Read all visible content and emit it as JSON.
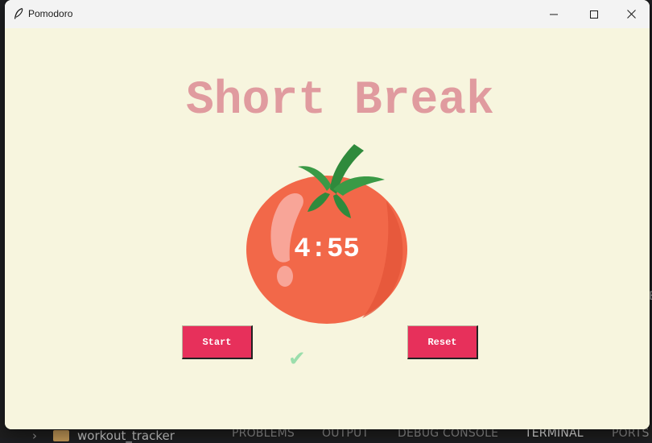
{
  "window": {
    "title": "Pomodoro"
  },
  "main": {
    "heading": "Short Break",
    "timer": "4:55",
    "checkmarks": "✔"
  },
  "buttons": {
    "start_label": "Start",
    "reset_label": "Reset"
  },
  "background_panel": {
    "folder_label": "workout_tracker",
    "tabs": [
      "PROBLEMS",
      "OUTPUT",
      "DEBUG CONSOLE",
      "TERMINAL",
      "PORTS"
    ],
    "active_tab": "TERMINAL"
  },
  "colors": {
    "window_bg": "#f7f5de",
    "heading": "#e09b9f",
    "button": "#e7305b",
    "checkmark": "#9bdeac",
    "tomato": "#f26849"
  },
  "icons": {
    "app": "feather-icon",
    "tomato": "tomato-icon",
    "minimize": "minimize-icon",
    "maximize": "maximize-icon",
    "close": "close-icon"
  }
}
